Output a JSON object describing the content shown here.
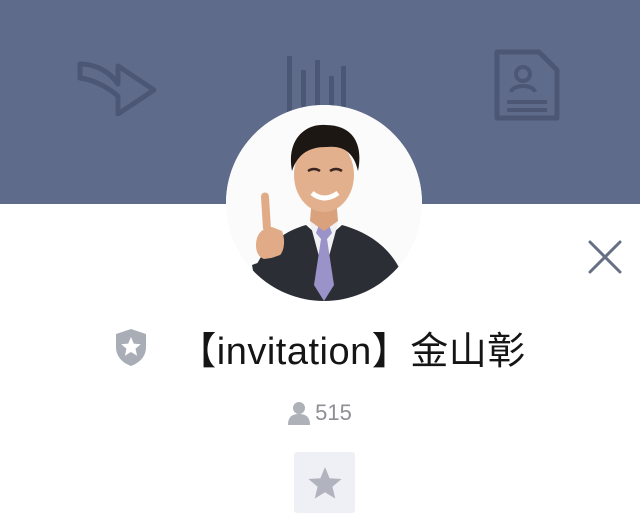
{
  "header": {
    "icons": [
      "share-arrow-icon",
      "stats-icon",
      "profile-document-icon"
    ],
    "background": "#5f6b8b"
  },
  "profile": {
    "avatar": "person-photo",
    "badge_icon": "shield-star-badge-icon",
    "name": "【invitation】金山彰",
    "friends_icon": "person-icon",
    "friends_count": "515"
  },
  "actions": {
    "close_icon": "close-x-icon",
    "favorite_icon": "star-icon"
  }
}
